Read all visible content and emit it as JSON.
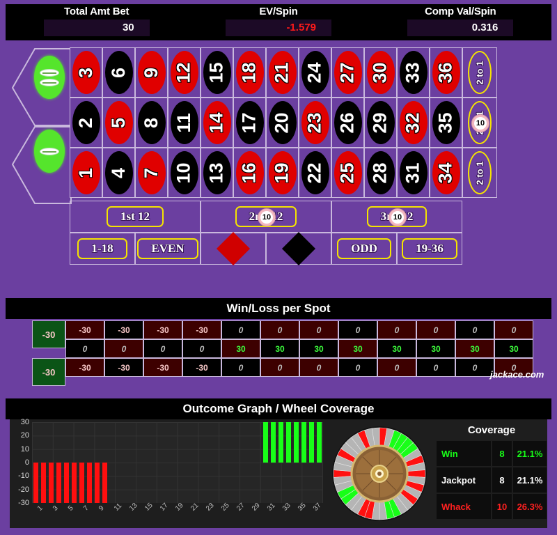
{
  "header": {
    "stats": [
      {
        "label": "Total Amt Bet",
        "value": "30",
        "negative": false
      },
      {
        "label": "EV/Spin",
        "value": "-1.579",
        "negative": true
      },
      {
        "label": "Comp Val/Spin",
        "value": "0.316",
        "negative": false
      }
    ]
  },
  "table": {
    "zeros": [
      {
        "name": "00",
        "label": "00"
      },
      {
        "name": "0",
        "label": "0"
      }
    ],
    "rows": [
      {
        "numbers": [
          {
            "n": "3",
            "color": "red"
          },
          {
            "n": "6",
            "color": "black"
          },
          {
            "n": "9",
            "color": "red"
          },
          {
            "n": "12",
            "color": "red"
          },
          {
            "n": "15",
            "color": "black"
          },
          {
            "n": "18",
            "color": "red"
          },
          {
            "n": "21",
            "color": "red"
          },
          {
            "n": "24",
            "color": "black"
          },
          {
            "n": "27",
            "color": "red"
          },
          {
            "n": "30",
            "color": "red"
          },
          {
            "n": "33",
            "color": "black"
          },
          {
            "n": "36",
            "color": "red"
          }
        ],
        "column_bet": "2 to 1",
        "chip": null
      },
      {
        "numbers": [
          {
            "n": "2",
            "color": "black"
          },
          {
            "n": "5",
            "color": "red"
          },
          {
            "n": "8",
            "color": "black"
          },
          {
            "n": "11",
            "color": "black"
          },
          {
            "n": "14",
            "color": "red"
          },
          {
            "n": "17",
            "color": "black"
          },
          {
            "n": "20",
            "color": "black"
          },
          {
            "n": "23",
            "color": "red"
          },
          {
            "n": "26",
            "color": "black"
          },
          {
            "n": "29",
            "color": "black"
          },
          {
            "n": "32",
            "color": "red"
          },
          {
            "n": "35",
            "color": "black"
          }
        ],
        "column_bet": "2 to 1",
        "chip": "10"
      },
      {
        "numbers": [
          {
            "n": "1",
            "color": "red"
          },
          {
            "n": "4",
            "color": "black"
          },
          {
            "n": "7",
            "color": "red"
          },
          {
            "n": "10",
            "color": "black"
          },
          {
            "n": "13",
            "color": "black"
          },
          {
            "n": "16",
            "color": "red"
          },
          {
            "n": "19",
            "color": "red"
          },
          {
            "n": "22",
            "color": "black"
          },
          {
            "n": "25",
            "color": "red"
          },
          {
            "n": "28",
            "color": "black"
          },
          {
            "n": "31",
            "color": "black"
          },
          {
            "n": "34",
            "color": "red"
          }
        ],
        "column_bet": "2 to 1",
        "chip": null
      }
    ],
    "dozens": [
      {
        "label": "1st 12",
        "chip": null
      },
      {
        "label": "2nd 12",
        "chip": "10"
      },
      {
        "label": "3rd 12",
        "chip": "10"
      }
    ],
    "outside": [
      {
        "label": "1-18",
        "kind": "text",
        "chip": null
      },
      {
        "label": "EVEN",
        "kind": "text",
        "chip": null
      },
      {
        "label": "RED",
        "kind": "diamond-red",
        "chip": null
      },
      {
        "label": "BLACK",
        "kind": "diamond-black",
        "chip": null
      },
      {
        "label": "ODD",
        "kind": "text",
        "chip": null
      },
      {
        "label": "19-36",
        "kind": "text",
        "chip": null
      }
    ]
  },
  "winloss": {
    "title": "Win/Loss per Spot",
    "zero_cells": [
      {
        "label": "00",
        "value": "-30"
      },
      {
        "label": "0",
        "value": "-30"
      }
    ],
    "rows": [
      {
        "values": [
          "-30",
          "-30",
          "-30",
          "-30",
          "0",
          "0",
          "0",
          "0",
          "0",
          "0",
          "0",
          "0"
        ],
        "colors": [
          "red",
          "black",
          "red",
          "red",
          "black",
          "red",
          "red",
          "black",
          "red",
          "red",
          "black",
          "red"
        ]
      },
      {
        "values": [
          "0",
          "0",
          "0",
          "0",
          "30",
          "30",
          "30",
          "30",
          "30",
          "30",
          "30",
          "30"
        ],
        "colors": [
          "black",
          "red",
          "black",
          "black",
          "red",
          "black",
          "black",
          "red",
          "black",
          "black",
          "red",
          "black"
        ]
      },
      {
        "values": [
          "-30",
          "-30",
          "-30",
          "-30",
          "0",
          "0",
          "0",
          "0",
          "0",
          "0",
          "0",
          "0"
        ],
        "colors": [
          "red",
          "black",
          "red",
          "black",
          "black",
          "red",
          "red",
          "black",
          "red",
          "black",
          "black",
          "red"
        ]
      }
    ],
    "watermark": "jackace.com"
  },
  "outcome": {
    "title": "Outcome Graph / Wheel Coverage",
    "coverage": {
      "title": "Coverage",
      "rows": [
        {
          "name": "Win",
          "count": "8",
          "pct": "21.1%",
          "style": "win"
        },
        {
          "name": "Jackpot",
          "count": "8",
          "pct": "21.1%",
          "style": "jackpot"
        },
        {
          "name": "Whack",
          "count": "10",
          "pct": "26.3%",
          "style": "whack"
        }
      ]
    }
  },
  "chart_data": {
    "type": "bar",
    "title": "Outcome Graph / Wheel Coverage",
    "xlabel": "",
    "ylabel": "",
    "ylim": [
      -30,
      30
    ],
    "yticks": [
      30,
      20,
      10,
      0,
      -10,
      -20,
      -30
    ],
    "xticks": [
      "1",
      "3",
      "5",
      "7",
      "9",
      "11",
      "13",
      "15",
      "17",
      "19",
      "21",
      "23",
      "25",
      "27",
      "29",
      "31",
      "33",
      "35",
      "37"
    ],
    "x": [
      1,
      2,
      3,
      4,
      5,
      6,
      7,
      8,
      9,
      10,
      11,
      12,
      13,
      14,
      15,
      16,
      17,
      18,
      19,
      20,
      21,
      22,
      23,
      24,
      25,
      26,
      27,
      28,
      29,
      30,
      31,
      32,
      33,
      34,
      35,
      36,
      37,
      38
    ],
    "values": [
      -30,
      -30,
      -30,
      -30,
      -30,
      -30,
      -30,
      -30,
      -30,
      -30,
      0,
      0,
      0,
      0,
      0,
      0,
      0,
      0,
      0,
      0,
      0,
      0,
      0,
      0,
      0,
      0,
      0,
      0,
      0,
      0,
      30,
      30,
      30,
      30,
      30,
      30,
      30,
      30
    ],
    "grid": true,
    "legend": false,
    "colors": {
      "negative": "#ff0f0f",
      "positive": "#18ff18",
      "plot_bg": "#262626"
    }
  }
}
